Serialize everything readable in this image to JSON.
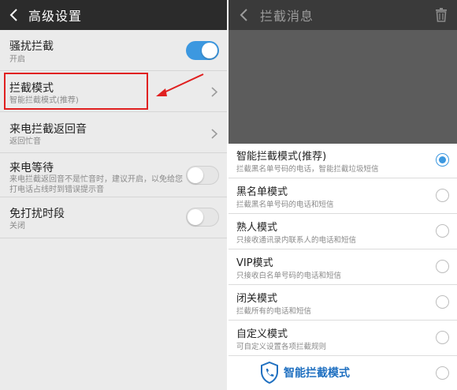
{
  "left": {
    "header": {
      "title": "高级设置"
    },
    "settings": [
      {
        "title": "骚扰拦截",
        "subtitle": "开启",
        "control": "toggle",
        "enabled": true
      },
      {
        "title": "拦截模式",
        "subtitle": "智能拦截模式(推荐)",
        "control": "chevron"
      },
      {
        "title": "来电拦截返回音",
        "subtitle": "返回忙音",
        "control": "chevron"
      },
      {
        "title": "来电等待",
        "subtitle": "来电拦截返回音不是忙音时，建议开启，以免给您打电话占线时到错误提示音",
        "control": "toggle",
        "enabled": false
      },
      {
        "title": "免打扰时段",
        "subtitle": "关闭",
        "control": "toggle",
        "enabled": false
      }
    ]
  },
  "right": {
    "header": {
      "title": "拦截消息"
    },
    "modes": [
      {
        "title": "智能拦截模式(推荐)",
        "subtitle": "拦截黑名单号码的电话，智能拦截垃圾短信",
        "selected": true
      },
      {
        "title": "黑名单模式",
        "subtitle": "拦截黑名单号码的电话和短信",
        "selected": false
      },
      {
        "title": "熟人模式",
        "subtitle": "只接收通讯录内联系人的电话和短信",
        "selected": false
      },
      {
        "title": "VIP模式",
        "subtitle": "只接收白名单号码的电话和短信",
        "selected": false
      },
      {
        "title": "闭关模式",
        "subtitle": "拦截所有的电话和短信",
        "selected": false
      },
      {
        "title": "自定义模式",
        "subtitle": "可自定义设置各项拦截规则",
        "selected": false
      }
    ],
    "watermark": "智能拦截模式"
  },
  "colors": {
    "accent": "#3c98e0",
    "annotation": "#e02020",
    "header_dark": "#2b2b2b"
  },
  "icons": {
    "back": "back-arrow-icon",
    "chevron": "chevron-right-icon",
    "trash": "trash-icon",
    "shield": "shield-phone-icon"
  }
}
